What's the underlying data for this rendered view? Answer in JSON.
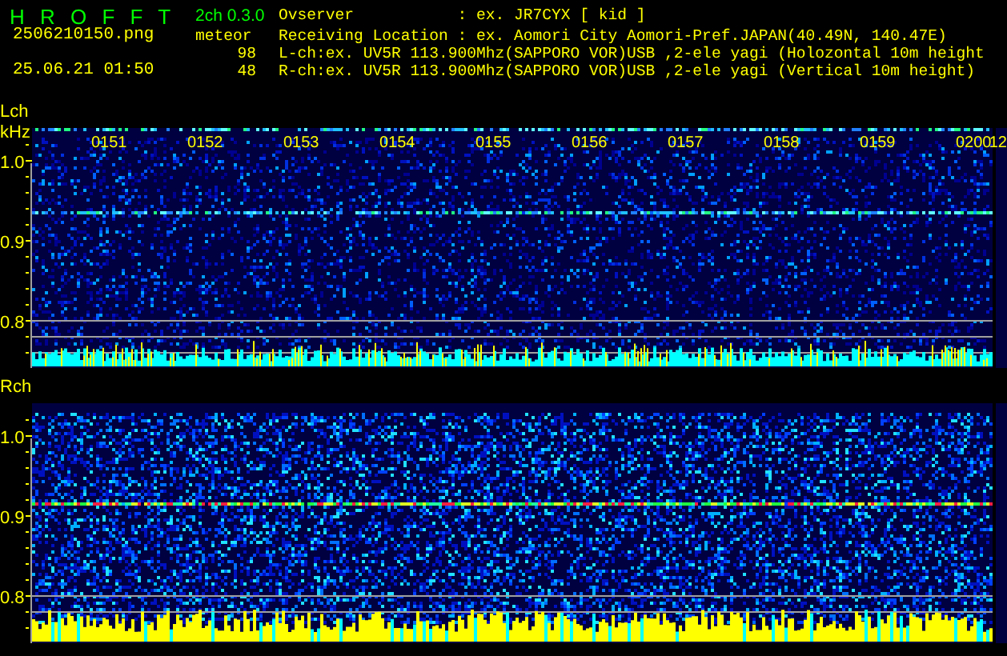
{
  "header": {
    "title": "H R O F F T",
    "version": "2ch 0.3.0",
    "filename": "2506210150.png",
    "datetime": "25.06.21 01:50",
    "meteor_label": "meteor",
    "meteor_counts": [
      "98",
      "48"
    ],
    "info_lines": [
      "Ovserver           : ex. JR7CYX [ kid ]",
      "Receiving Location : ex. Aomori City Aomori-Pref.JAPAN(40.49N, 140.47E)",
      "L-ch:ex. UV5R 113.900Mhz(SAPPORO VOR)USB ,2-ele yagi (Holozontal 10m height",
      "R-ch:ex. UV5R 113.900Mhz(SAPPORO VOR)USB ,2-ele yagi (Vertical 10m height)"
    ]
  },
  "channels": [
    {
      "label": "Lch",
      "unit": "kHz",
      "y_ticks": [
        "1.0",
        "0.9",
        "0.8"
      ],
      "time_labels": [
        {
          "text": "0151",
          "kind": "minute"
        },
        {
          "text": "0152",
          "kind": "minute"
        },
        {
          "text": "0153",
          "kind": "minute"
        },
        {
          "text": "0154",
          "kind": "minute"
        },
        {
          "text": "0155",
          "kind": "minute"
        },
        {
          "text": "0156",
          "kind": "minute"
        },
        {
          "text": "0157",
          "kind": "minute"
        },
        {
          "text": "0158",
          "kind": "minute"
        },
        {
          "text": "0159",
          "kind": "minute"
        },
        {
          "text": "0200",
          "kind": "minute"
        },
        {
          "text": "12",
          "kind": "partial"
        }
      ]
    },
    {
      "label": "Rch",
      "y_ticks": [
        "1.0",
        "0.9",
        "0.8"
      ]
    }
  ]
}
